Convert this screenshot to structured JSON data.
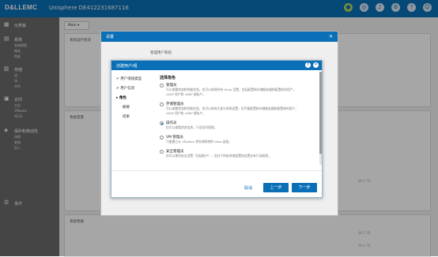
{
  "app": {
    "logo": "D&LLEMC",
    "title": "Unisphere DE412231687116"
  },
  "topbar_icons": [
    "status-icon",
    "jobs-icon",
    "alerts-icon",
    "settings-icon",
    "help-icon",
    "user-icon"
  ],
  "sidebar": {
    "groups": [
      {
        "icon": "dashboard-icon",
        "title": "仪表板",
        "items": []
      },
      {
        "icon": "system-icon",
        "title": "系统",
        "items": [
          "系统视图",
          "服务",
          "性能"
        ]
      },
      {
        "icon": "storage-icon",
        "title": "存储",
        "items": [
          "池",
          "块",
          "文件"
        ]
      },
      {
        "icon": "access-icon",
        "title": "访问",
        "items": [
          "主机",
          "VMware",
          "iSCSI"
        ]
      },
      {
        "icon": "protection-icon",
        "title": "保护和移动性",
        "items": [
          "快照",
          "复制",
          "导入"
        ]
      },
      {
        "icon": "events-icon",
        "title": "事件",
        "items": []
      }
    ]
  },
  "main": {
    "tab": "Main",
    "panels": [
      "系统运行状况",
      "系统容量",
      "系统性能"
    ],
    "values": [
      "96.5 TB",
      "96.5 TB",
      "96.5 TB"
    ]
  },
  "outer_dialog": {
    "title": "设置",
    "tab": "管理用户和组"
  },
  "wizard": {
    "title": "创建用户/组",
    "steps": [
      {
        "label": "用户或组类型",
        "state": "done"
      },
      {
        "label": "用户信息",
        "state": "done"
      },
      {
        "label": "角色",
        "state": "current"
      },
      {
        "label": "摘要",
        "state": "todo"
      },
      {
        "label": "结果",
        "state": "todo"
      }
    ],
    "section_title": "选择角色",
    "options": [
      {
        "name": "管理员",
        "desc": "可以查看状态和性能信息。也可以修改所有 Unity 设置，包括配置新存储服务器和配置新的用户，LDAP 用户和 LDAP 组帐户。",
        "selected": false
      },
      {
        "name": "存储管理员",
        "desc": "可以查看状态和性能信息。也可以修改大部分系统设置，但不能配置新存储服务器和配置新的用户，LDAP 用户和 LDAP 组帐户。",
        "selected": false
      },
      {
        "name": "操作员",
        "desc": "仅可以查看状态信息，只读访问权限。",
        "selected": true
      },
      {
        "name": "VM 管理员",
        "desc": "只能建立从 VSphere 到存储系统的 Vasa 连接。",
        "selected": false
      },
      {
        "name": "安全管理员",
        "desc": "仅可以更改安全设置（包括帐户），但对于所有其他配置和设置仅有只读权限。",
        "selected": false
      }
    ],
    "buttons": {
      "cancel": "取消",
      "back": "上一步",
      "next": "下一步"
    }
  }
}
